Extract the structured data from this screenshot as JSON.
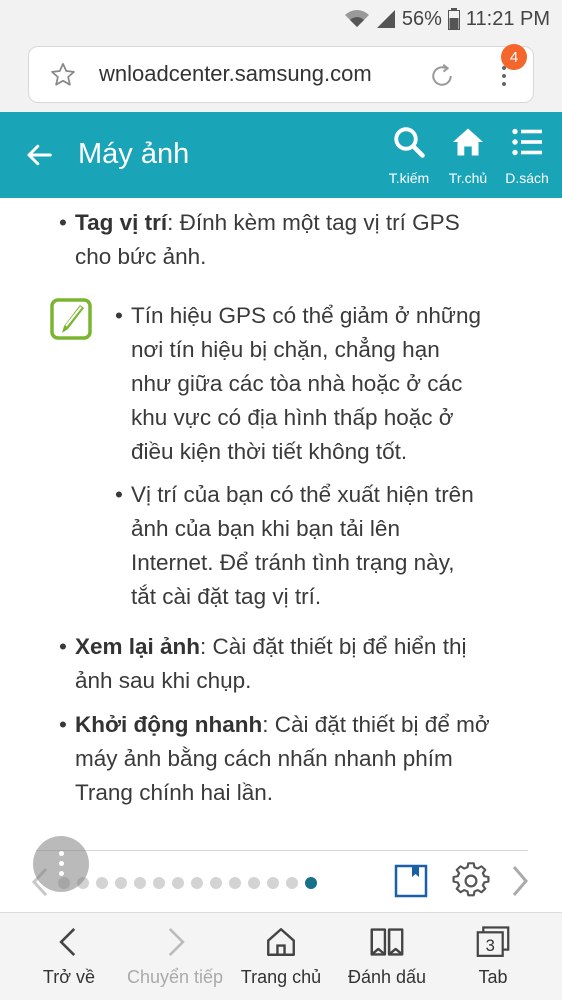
{
  "status": {
    "battery": "56%",
    "time": "11:21 PM"
  },
  "browser": {
    "url": "wnloadcenter.samsung.com",
    "badge_count": "4"
  },
  "appbar": {
    "title": "Máy ảnh",
    "actions": [
      {
        "icon": "search-icon",
        "label": "T.kiếm"
      },
      {
        "icon": "home-icon",
        "label": "Tr.chủ"
      },
      {
        "icon": "list-icon",
        "label": "D.sách"
      }
    ]
  },
  "content": {
    "items": [
      {
        "term": "Tag vị trí",
        "line1": ": Đính kèm một tag vị trí GPS",
        "line2": "cho bức ảnh."
      },
      {
        "lines": [
          "Tín hiệu GPS có thể giảm ở những",
          "nơi tín hiệu bị chặn, chẳng hạn",
          "như giữa các tòa nhà hoặc ở các",
          "khu vực có địa hình thấp hoặc ở",
          "điều kiện thời tiết không tốt."
        ]
      },
      {
        "lines": [
          "Vị trí của bạn có thể xuất hiện trên",
          "ảnh của bạn khi bạn tải lên",
          "Internet. Để tránh tình trạng này,",
          "tắt cài đặt tag vị trí."
        ]
      },
      {
        "term": "Xem lại ảnh",
        "line1": ": Cài đặt thiết bị để hiển thị",
        "line2": "ảnh sau khi chụp."
      },
      {
        "term": "Khởi động nhanh",
        "line1": ": Cài đặt thiết bị để mở",
        "line2": "máy ảnh bằng cách nhấn nhanh phím",
        "line3": "Trang chính hai lần."
      }
    ]
  },
  "pager": {
    "total": 14,
    "active_index": 13
  },
  "bottom_nav": [
    {
      "label": "Trở về",
      "icon": "back-icon",
      "enabled": true
    },
    {
      "label": "Chuyển tiếp",
      "icon": "forward-icon",
      "enabled": false
    },
    {
      "label": "Trang chủ",
      "icon": "home-icon",
      "enabled": true
    },
    {
      "label": "Đánh dấu",
      "icon": "bookmarks-icon",
      "enabled": true
    },
    {
      "label": "Tab",
      "icon": "tabs-icon",
      "enabled": true,
      "count": "3"
    }
  ]
}
